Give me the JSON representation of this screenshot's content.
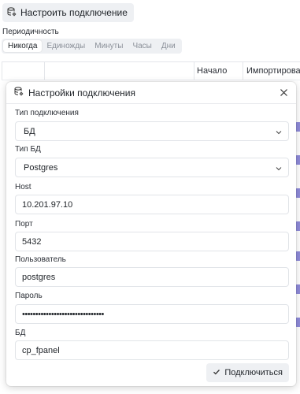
{
  "toolbar": {
    "configure_label": "Настроить подключение"
  },
  "schedule": {
    "label": "Периодичность",
    "options": [
      "Никогда",
      "Единожды",
      "Минуты",
      "Часы",
      "Дни"
    ],
    "active": "Никогда"
  },
  "table": {
    "columns": [
      "Начало",
      "Импортирован"
    ]
  },
  "modal": {
    "title": "Настройки подключения",
    "fields": {
      "conn_type": {
        "label": "Тип подключения",
        "value": "БД"
      },
      "db_type": {
        "label": "Тип БД",
        "value": "Postgres"
      },
      "host": {
        "label": "Host",
        "value": "10.201.97.10"
      },
      "port": {
        "label": "Порт",
        "value": "5432"
      },
      "user": {
        "label": "Пользователь",
        "value": "postgres"
      },
      "password": {
        "label": "Пароль",
        "value": "•••••••••••••••••••••••••••••••"
      },
      "db": {
        "label": "БД",
        "value": "cp_fpanel"
      }
    },
    "connect_label": "Подключиться"
  },
  "colors": {
    "accent": "#8f8bd9"
  }
}
